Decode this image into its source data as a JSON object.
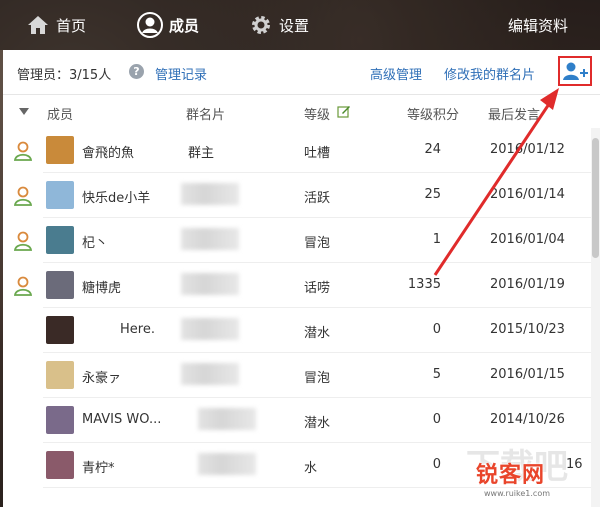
{
  "nav": {
    "tabs": [
      {
        "label": "首页",
        "icon": "home-icon"
      },
      {
        "label": "成员",
        "icon": "member-icon"
      },
      {
        "label": "设置",
        "icon": "gear-icon"
      }
    ],
    "edit_profile": "编辑资料"
  },
  "manager_bar": {
    "admins": "管理员：3/15人",
    "log": "管理记录",
    "advanced": "高级管理",
    "edit_card": "修改我的群名片",
    "add_icon": "add-member-icon"
  },
  "columns": {
    "member": "成员",
    "card": "群名片",
    "level": "等级",
    "points": "等级积分",
    "last": "最后发言"
  },
  "members": [
    {
      "name": "會飛的魚",
      "card": "群主",
      "level": "吐槽",
      "points": "24",
      "last": "2016/01/12",
      "role": "admin"
    },
    {
      "name": "快乐de小羊",
      "card": "",
      "level": "活跃",
      "points": "25",
      "last": "2016/01/14",
      "role": "admin"
    },
    {
      "name": "杞丶",
      "card": "",
      "level": "冒泡",
      "points": "1",
      "last": "2016/01/04",
      "role": "admin"
    },
    {
      "name": "糖博虎",
      "card": "",
      "level": "话唠",
      "points": "1335",
      "last": "2016/01/19",
      "role": "admin"
    },
    {
      "name": "Here.",
      "card": "",
      "level": "潜水",
      "points": "0",
      "last": "2015/10/23",
      "role": ""
    },
    {
      "name": "永豪ァ",
      "card": "",
      "level": "冒泡",
      "points": "5",
      "last": "2016/01/15",
      "role": ""
    },
    {
      "name": "MAVIS WO...",
      "card": "",
      "level": "潜水",
      "points": "0",
      "last": "2014/10/26",
      "role": ""
    },
    {
      "name": "青柠*",
      "card": "",
      "level": "水",
      "points": "0",
      "last": "16",
      "role": ""
    }
  ],
  "watermark": {
    "main": "锐客网",
    "sub": "www.ruike1.com",
    "big": "下载吧"
  },
  "colors": {
    "link": "#2f6fb7",
    "highlight": "#e02b2b",
    "admin_icon": "#d98a3d"
  }
}
